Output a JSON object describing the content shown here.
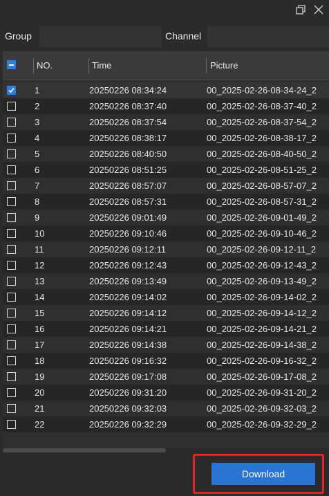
{
  "filters": {
    "group_label": "Group",
    "group_value": "",
    "channel_label": "Channel",
    "channel_value": ""
  },
  "table": {
    "headers": {
      "no": "NO.",
      "time": "Time",
      "picture": "Picture"
    },
    "rows": [
      {
        "no": "1",
        "time": "20250226 08:34:24",
        "picture": "00_2025-02-26-08-34-24_2",
        "checked": true
      },
      {
        "no": "2",
        "time": "20250226 08:37:40",
        "picture": "00_2025-02-26-08-37-40_2",
        "checked": false
      },
      {
        "no": "3",
        "time": "20250226 08:37:54",
        "picture": "00_2025-02-26-08-37-54_2",
        "checked": false
      },
      {
        "no": "4",
        "time": "20250226 08:38:17",
        "picture": "00_2025-02-26-08-38-17_2",
        "checked": false
      },
      {
        "no": "5",
        "time": "20250226 08:40:50",
        "picture": "00_2025-02-26-08-40-50_2",
        "checked": false
      },
      {
        "no": "6",
        "time": "20250226 08:51:25",
        "picture": "00_2025-02-26-08-51-25_2",
        "checked": false
      },
      {
        "no": "7",
        "time": "20250226 08:57:07",
        "picture": "00_2025-02-26-08-57-07_2",
        "checked": false
      },
      {
        "no": "8",
        "time": "20250226 08:57:31",
        "picture": "00_2025-02-26-08-57-31_2",
        "checked": false
      },
      {
        "no": "9",
        "time": "20250226 09:01:49",
        "picture": "00_2025-02-26-09-01-49_2",
        "checked": false
      },
      {
        "no": "10",
        "time": "20250226 09:10:46",
        "picture": "00_2025-02-26-09-10-46_2",
        "checked": false
      },
      {
        "no": "11",
        "time": "20250226 09:12:11",
        "picture": "00_2025-02-26-09-12-11_2",
        "checked": false
      },
      {
        "no": "12",
        "time": "20250226 09:12:43",
        "picture": "00_2025-02-26-09-12-43_2",
        "checked": false
      },
      {
        "no": "13",
        "time": "20250226 09:13:49",
        "picture": "00_2025-02-26-09-13-49_2",
        "checked": false
      },
      {
        "no": "14",
        "time": "20250226 09:14:02",
        "picture": "00_2025-02-26-09-14-02_2",
        "checked": false
      },
      {
        "no": "15",
        "time": "20250226 09:14:12",
        "picture": "00_2025-02-26-09-14-12_2",
        "checked": false
      },
      {
        "no": "16",
        "time": "20250226 09:14:21",
        "picture": "00_2025-02-26-09-14-21_2",
        "checked": false
      },
      {
        "no": "17",
        "time": "20250226 09:14:38",
        "picture": "00_2025-02-26-09-14-38_2",
        "checked": false
      },
      {
        "no": "18",
        "time": "20250226 09:16:32",
        "picture": "00_2025-02-26-09-16-32_2",
        "checked": false
      },
      {
        "no": "19",
        "time": "20250226 09:17:08",
        "picture": "00_2025-02-26-09-17-08_2",
        "checked": false
      },
      {
        "no": "20",
        "time": "20250226 09:31:20",
        "picture": "00_2025-02-26-09-31-20_2",
        "checked": false
      },
      {
        "no": "21",
        "time": "20250226 09:32:03",
        "picture": "00_2025-02-26-09-32-03_2",
        "checked": false
      },
      {
        "no": "22",
        "time": "20250226 09:32:29",
        "picture": "00_2025-02-26-09-32-29_2",
        "checked": false
      }
    ]
  },
  "footer": {
    "download_label": "Download"
  },
  "colors": {
    "accent": "#2a74d3",
    "highlight": "#e0252b",
    "background": "#2b2b2b"
  },
  "icons": {
    "restore": "restore-window-icon",
    "close": "close-icon",
    "select_all": "partial-checkbox-icon"
  }
}
